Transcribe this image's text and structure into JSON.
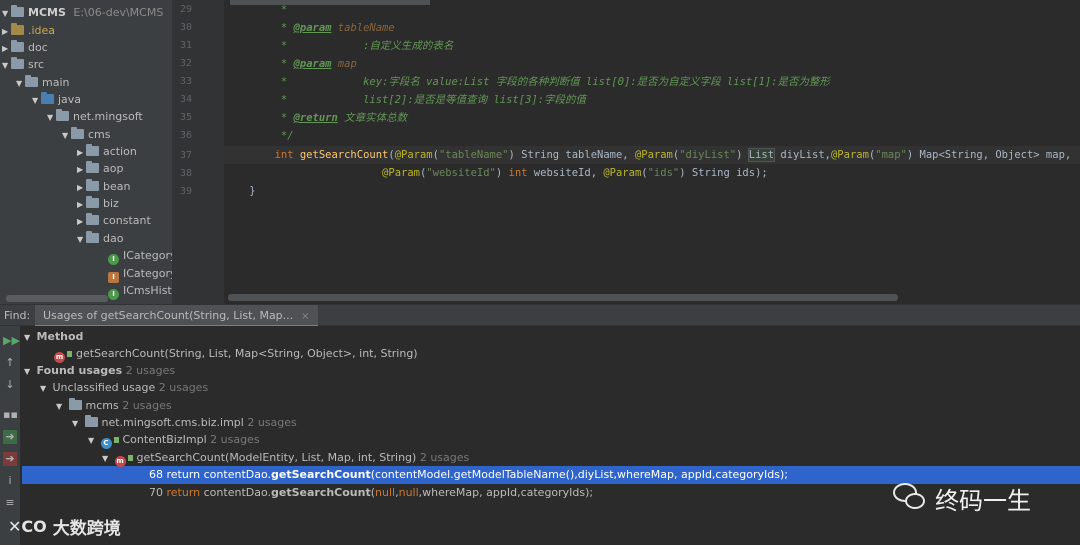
{
  "project": {
    "root_name": "MCMS",
    "root_path": "E:\\06-dev\\MCMS",
    "items": [
      {
        "label": ".idea"
      },
      {
        "label": "doc"
      },
      {
        "label": "src"
      },
      {
        "label": "main"
      },
      {
        "label": "java"
      },
      {
        "label": "net.mingsoft"
      },
      {
        "label": "cms"
      },
      {
        "label": "action"
      },
      {
        "label": "aop"
      },
      {
        "label": "bean"
      },
      {
        "label": "biz"
      },
      {
        "label": "constant"
      },
      {
        "label": "dao"
      },
      {
        "label": "ICategory"
      },
      {
        "label": "ICategory"
      },
      {
        "label": "ICmsHistc"
      }
    ]
  },
  "editor": {
    "line_numbers": [
      "29",
      "30",
      "31",
      "32",
      "33",
      "34",
      "35",
      "36",
      "37",
      "38",
      "39"
    ],
    "lines": {
      "l29": "         *",
      "l30_pre": "         * ",
      "l30_tag": "@param",
      "l30_val": " tableName",
      "l31": "         *            :自定义生成的表名",
      "l32_pre": "         * ",
      "l32_tag": "@param",
      "l32_val": " map",
      "l33": "         *            key:字段名 value:List 字段的各种判断值 list[0]:是否为自定义字段 list[1]:是否为整形",
      "l34": "         *            list[2]:是否是等值查询 list[3]:字段的值",
      "l35_pre": "         * ",
      "l35_tag": "@return",
      "l35_val": " 文章实体总数",
      "l36": "         */",
      "l37_kw": "        int ",
      "l37_fn": "getSearchCount",
      "l37_a": "(",
      "l37_ann1": "@Param",
      "l37_b": "(",
      "l37_s1": "\"tableName\"",
      "l37_c": ") String tableName, ",
      "l37_ann2": "@Param",
      "l37_d": "(",
      "l37_s2": "\"diyList\"",
      "l37_e": ") ",
      "l37_list": "List",
      "l37_f": " diyList,",
      "l37_ann3": "@Param",
      "l37_g": "(",
      "l37_s3": "\"map\"",
      "l37_h": ") Map<String, Object> map,",
      "l38_pad": "                         ",
      "l38_ann1": "@Param",
      "l38_a": "(",
      "l38_s1": "\"websiteId\"",
      "l38_b": ") ",
      "l38_kw": "int",
      "l38_c": " websiteId, ",
      "l38_ann2": "@Param",
      "l38_d": "(",
      "l38_s2": "\"ids\"",
      "l38_e": ") String ids);",
      "l39": "    }"
    }
  },
  "find": {
    "label": "Find:",
    "tab_label": "Usages of getSearchCount(String, List, Map...",
    "tab_close": "×",
    "method_header": "Method",
    "method_sig": "getSearchCount(String, List, Map<String, Object>, int, String)",
    "found_label": "Found usages",
    "found_count": "2 usages",
    "unclassified_label": "Unclassified usage",
    "unclassified_count": "2 usages",
    "mcms_label": "mcms",
    "mcms_count": "2 usages",
    "pkg_label": "net.mingsoft.cms.biz.impl",
    "pkg_count": "2 usages",
    "class_label": "ContentBizImpl",
    "class_count": "2 usages",
    "impl_method_label": "getSearchCount(ModelEntity, List, Map, int, String)",
    "impl_method_count": "2 usages",
    "usage1": {
      "line": "68",
      "kw": "return",
      "pre": " contentDao.",
      "method": "getSearchCount",
      "args": "(contentModel.getModelTableName(),diyList,whereMap, appId,categoryIds);"
    },
    "usage2": {
      "line": "70",
      "kw": "return",
      "pre": " contentDao.",
      "method": "getSearchCount",
      "args_a": "(",
      "null1": "null",
      "comma": ",",
      "null2": "null",
      "args_b": ",whereMap, appId,categoryIds);"
    }
  },
  "watermark": {
    "right_text": "终码一生",
    "left_logo": "✕CO",
    "left_text": "大数跨境"
  },
  "colors": {
    "selection": "#2f65ca",
    "keyword": "#cc7832",
    "annotation": "#bbb529",
    "string": "#6a8759",
    "comment": "#629755",
    "function": "#ffc66d"
  }
}
